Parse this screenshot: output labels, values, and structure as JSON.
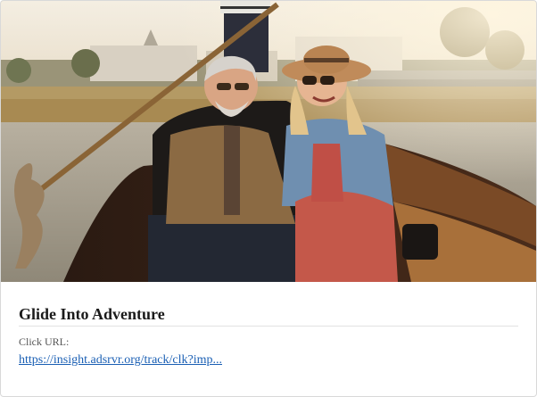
{
  "ad": {
    "title": "Glide Into Adventure",
    "click_url_label": "Click URL:",
    "click_url_display": "https://insight.adsrvr.org/track/clk?imp...",
    "image_alt": "Couple in a gondola on a river"
  },
  "colors": {
    "link": "#1a5fb4",
    "title": "#1a1a1a",
    "label": "#555555",
    "border": "#d9d9d9"
  }
}
